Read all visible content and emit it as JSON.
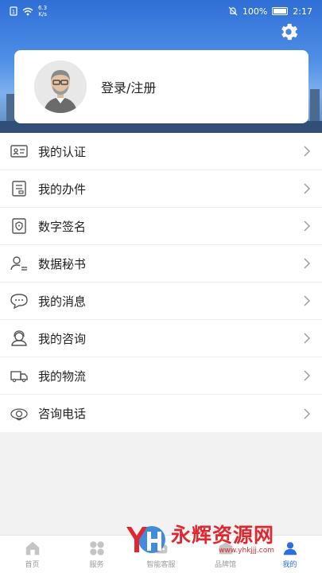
{
  "status_bar": {
    "speed_value": "6.3",
    "speed_unit": "K/s",
    "battery": "100%",
    "time": "2:17"
  },
  "header": {
    "settings_icon": "gear-icon"
  },
  "login_card": {
    "label": "登录/注册",
    "avatar_icon": "user-avatar"
  },
  "menu": {
    "items": [
      {
        "label": "我的认证",
        "icon": "id-card-icon"
      },
      {
        "label": "我的办件",
        "icon": "document-icon"
      },
      {
        "label": "数字签名",
        "icon": "signature-icon"
      },
      {
        "label": "数据秘书",
        "icon": "person-list-icon"
      },
      {
        "label": "我的消息",
        "icon": "chat-bubble-icon"
      },
      {
        "label": "我的咨询",
        "icon": "headset-icon"
      },
      {
        "label": "我的物流",
        "icon": "truck-icon"
      },
      {
        "label": "咨询电话",
        "icon": "phone-ring-icon"
      }
    ]
  },
  "tabbar": {
    "tabs": [
      {
        "label": "首页",
        "icon": "home-icon"
      },
      {
        "label": "服务",
        "icon": "grid-icon"
      },
      {
        "label": "智能客服",
        "icon": "robot-icon"
      },
      {
        "label": "品牌馆",
        "icon": "brand-icon"
      },
      {
        "label": "我的",
        "icon": "profile-icon",
        "active": true
      }
    ]
  },
  "watermark": {
    "title": "永辉资源网",
    "url": "www.yhkjjj.com"
  },
  "colors": {
    "accent": "#2a6fdb",
    "watermark": "#e0262e"
  }
}
